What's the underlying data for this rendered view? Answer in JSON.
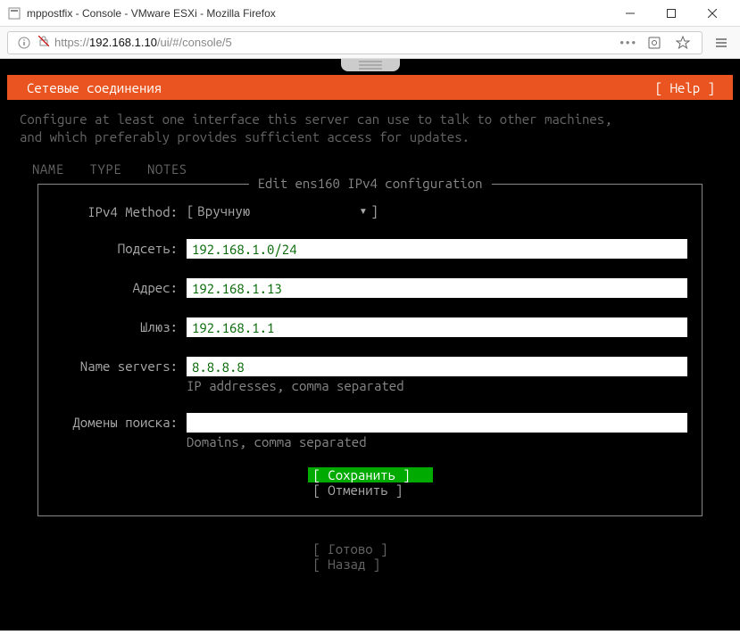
{
  "window": {
    "title": "mppostfix - Console - VMware ESXi - Mozilla Firefox"
  },
  "url": {
    "proto": "https://",
    "host": "192.168.1.10",
    "path": "/ui/#/console/5"
  },
  "tui": {
    "header": "Сетевые соединения",
    "help": "[ Help ]",
    "description": "Configure at least one interface this server can use to talk to other machines,\nand which preferably provides sufficient access for updates.",
    "columns": {
      "name": "NAME",
      "type": "TYPE",
      "notes": "NOTES"
    },
    "edit_title": "Edit ens160 IPv4 configuration",
    "method_label": "IPv4 Method:",
    "method_value": "Вручную",
    "fields": {
      "subnet": {
        "label": "Подсеть:",
        "value": "192.168.1.0/24"
      },
      "address": {
        "label": "Адрес:",
        "value": "192.168.1.13"
      },
      "gateway": {
        "label": "Шлюз:",
        "value": "192.168.1.1"
      },
      "nameservers": {
        "label": "Name servers:",
        "value": "8.8.8.8",
        "hint": "IP addresses, comma separated"
      },
      "searchdomains": {
        "label": "Домены поиска:",
        "value": "",
        "hint": "Domains, comma separated"
      }
    },
    "buttons": {
      "save": "[ Сохранить  ]",
      "cancel": "[ Отменить   ]",
      "done": "[ Готово    ]",
      "back": "[ Назад     ]"
    }
  }
}
